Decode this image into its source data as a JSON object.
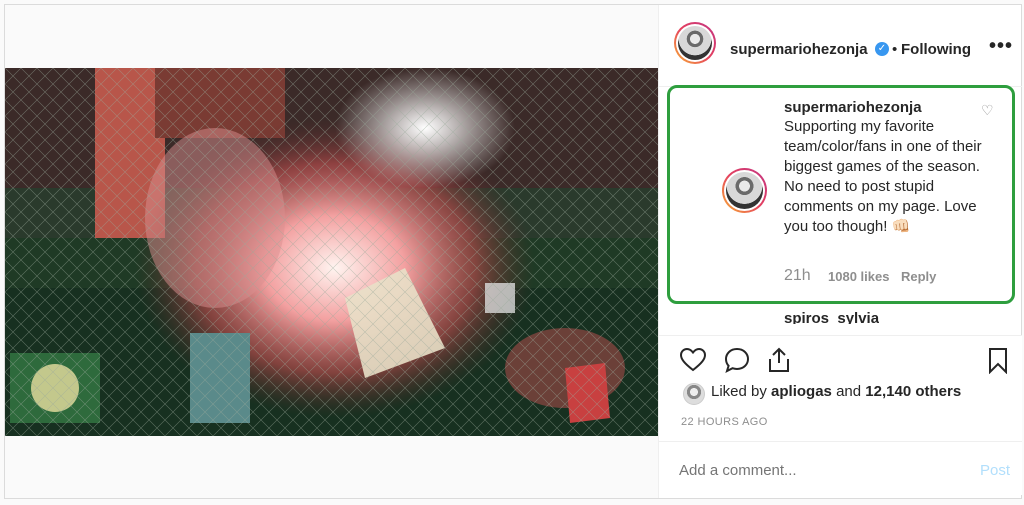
{
  "header": {
    "username": "supermariohezonja",
    "verified_symbol": "✓",
    "separator": "•",
    "follow_status": "Following",
    "more_symbol": "•••"
  },
  "caption": {
    "username": "supermariohezonja",
    "text": "Supporting my favorite team/color/fans in one of their biggest games of the season. No need to post stupid comments on my page. Love you too though! 👊🏻",
    "time": "21h",
    "likes": "1080 likes",
    "reply_label": "Reply"
  },
  "next_comment": {
    "username": "spiros_sylvia"
  },
  "likes": {
    "prefix": "Liked by ",
    "user": "apliogas",
    "middle": " and ",
    "others": "12,140 others"
  },
  "timestamp": "22 HOURS AGO",
  "add_comment": {
    "placeholder": "Add a comment...",
    "post_label": "Post"
  },
  "colors": {
    "highlight": "#2e9e3e",
    "verified": "#3897f0",
    "post_disabled": "#b2dffc"
  },
  "icons": [
    "heart-icon",
    "comment-icon",
    "share-icon",
    "bookmark-icon",
    "more-icon",
    "verified-icon"
  ]
}
